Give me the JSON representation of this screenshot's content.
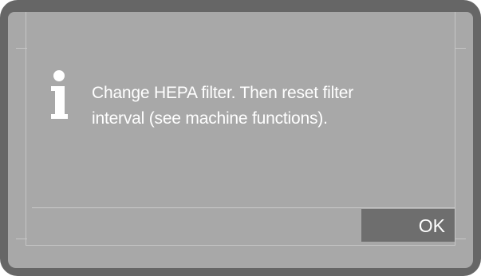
{
  "dialog": {
    "message_lines": [
      "Change HEPA filter. Then reset filter",
      "interval (see machine functions)."
    ],
    "icon": "info-icon",
    "ok_label": "OK"
  },
  "colors": {
    "frame": "#666666",
    "screen": "#a8a8a8",
    "button": "#6e6e6e",
    "text": "#ffffff"
  }
}
